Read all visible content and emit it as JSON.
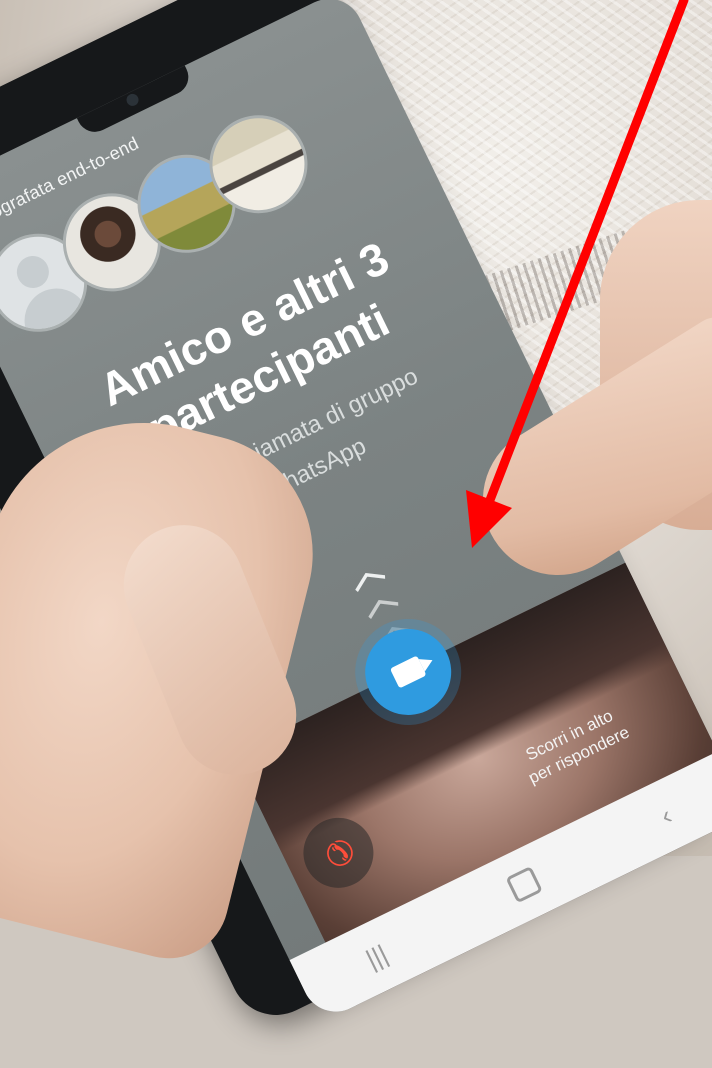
{
  "call_screen": {
    "encryption_label": "Crittografata end-to-end",
    "caller_name_line1": "Amico e altri 3",
    "caller_name_line2": "partecipanti",
    "call_type_line1": "Videochiamata di gruppo",
    "call_type_line2": "WhatsApp",
    "swipe_hint_line1": "Scorri in alto",
    "swipe_hint_line2": "per rispondere"
  },
  "icons": {
    "accept": "video-camera-icon",
    "decline": "phone-hangup-icon",
    "swipe": "chevron-up-icon",
    "nav_home": "home-square-icon",
    "nav_back": "back-chevron-icon"
  },
  "colors": {
    "accept_button": "#2f9be0",
    "decline_icon": "#ff4d3a",
    "annotation_arrow": "#ff0000"
  }
}
